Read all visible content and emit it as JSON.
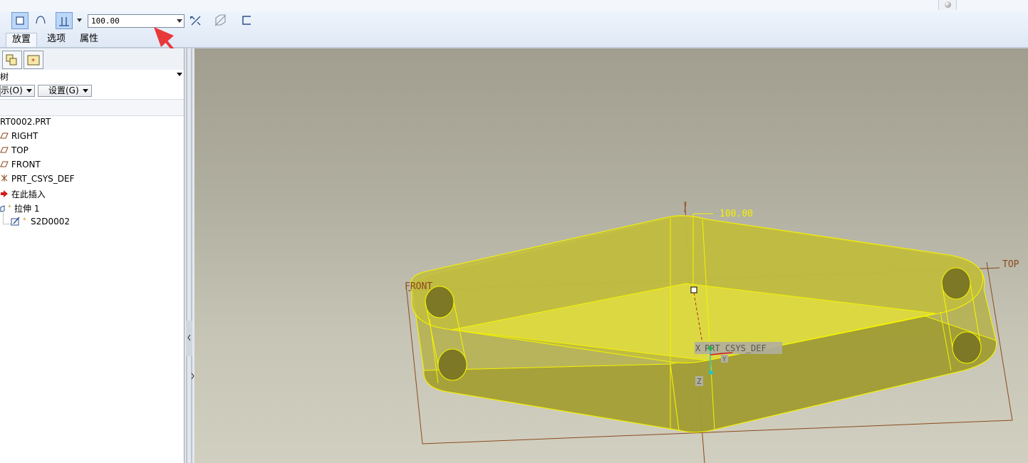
{
  "dashboard": {
    "depth_value": "100.00",
    "tabs": [
      {
        "label": "放置"
      },
      {
        "label": "选项"
      },
      {
        "label": "属性"
      }
    ]
  },
  "model_tree": {
    "header_label": "树",
    "show_button": "示(O)",
    "settings_button": "设置(G)",
    "items": [
      {
        "label": "RT0002.PRT",
        "icon": "part-icon"
      },
      {
        "label": "RIGHT",
        "icon": "datum-plane-icon"
      },
      {
        "label": "TOP",
        "icon": "datum-plane-icon"
      },
      {
        "label": "FRONT",
        "icon": "datum-plane-icon"
      },
      {
        "label": "PRT_CSYS_DEF",
        "icon": "csys-icon"
      },
      {
        "label": "在此插入",
        "icon": "insert-arrow-icon"
      },
      {
        "label": "拉伸 1",
        "icon": "extrude-icon"
      },
      {
        "label": "S2D0002",
        "icon": "sketch-icon"
      }
    ]
  },
  "viewport": {
    "dimension_label": "100.00",
    "plane_labels": {
      "front": "FRONT",
      "top": "TOP"
    },
    "csys_label": "PRT_CSYS_DEF",
    "axis_labels": {
      "x": "X",
      "z": "Z",
      "y": "Y"
    }
  },
  "colors": {
    "annotation_arrow": "#e8383a",
    "preview_fill": "#d8d63c",
    "preview_edge": "#f4f200",
    "datum": "#8b4a1e"
  }
}
